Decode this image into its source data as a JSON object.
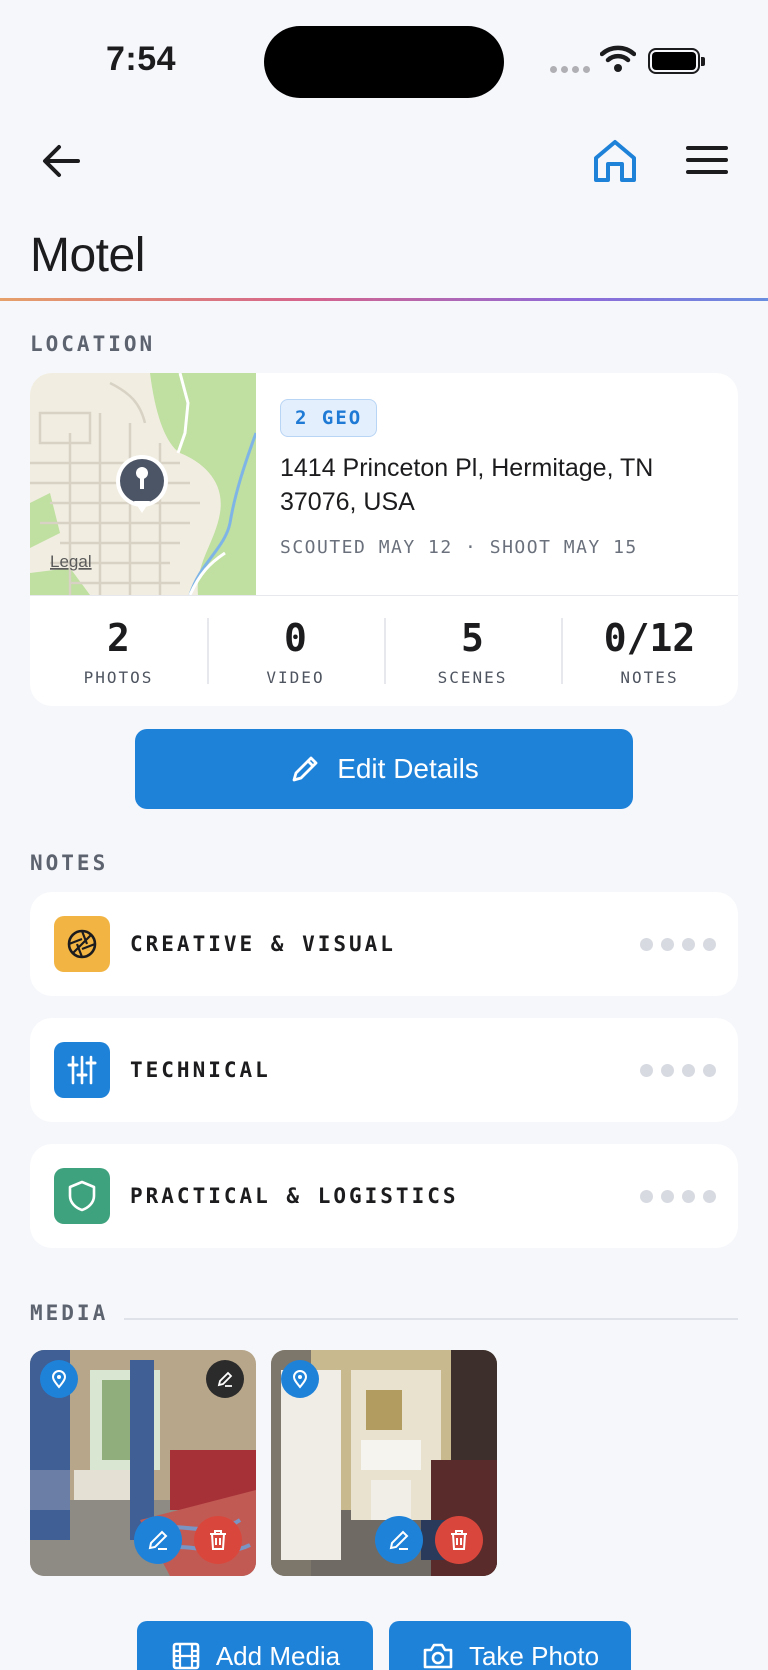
{
  "status_bar": {
    "time": "7:54"
  },
  "page": {
    "title": "Motel"
  },
  "location": {
    "section_label": "LOCATION",
    "map_legal": "Legal",
    "geo_badge": "2 GEO",
    "address": "1414 Princeton Pl, Hermitage, TN 37076, USA",
    "dates": "SCOUTED MAY 12 · SHOOT MAY 15",
    "stats": [
      {
        "value": "2",
        "label": "PHOTOS"
      },
      {
        "value": "0",
        "label": "VIDEO"
      },
      {
        "value": "5",
        "label": "SCENES"
      },
      {
        "value": "0/12",
        "label": "NOTES"
      }
    ]
  },
  "edit_button": {
    "label": "Edit Details"
  },
  "notes": {
    "section_label": "NOTES",
    "items": [
      {
        "title": "CREATIVE & VISUAL",
        "icon": "aperture-icon",
        "color": "#f2b544"
      },
      {
        "title": "TECHNICAL",
        "icon": "sliders-icon",
        "color": "#1f82d9"
      },
      {
        "title": "PRACTICAL & LOGISTICS",
        "icon": "shield-icon",
        "color": "#3fa27e"
      }
    ]
  },
  "media": {
    "section_label": "MEDIA",
    "add_media_label": "Add Media",
    "take_photo_label": "Take Photo"
  },
  "colors": {
    "accent": "#1f82d9",
    "danger": "#d9473c",
    "background": "#f6f7fb"
  }
}
